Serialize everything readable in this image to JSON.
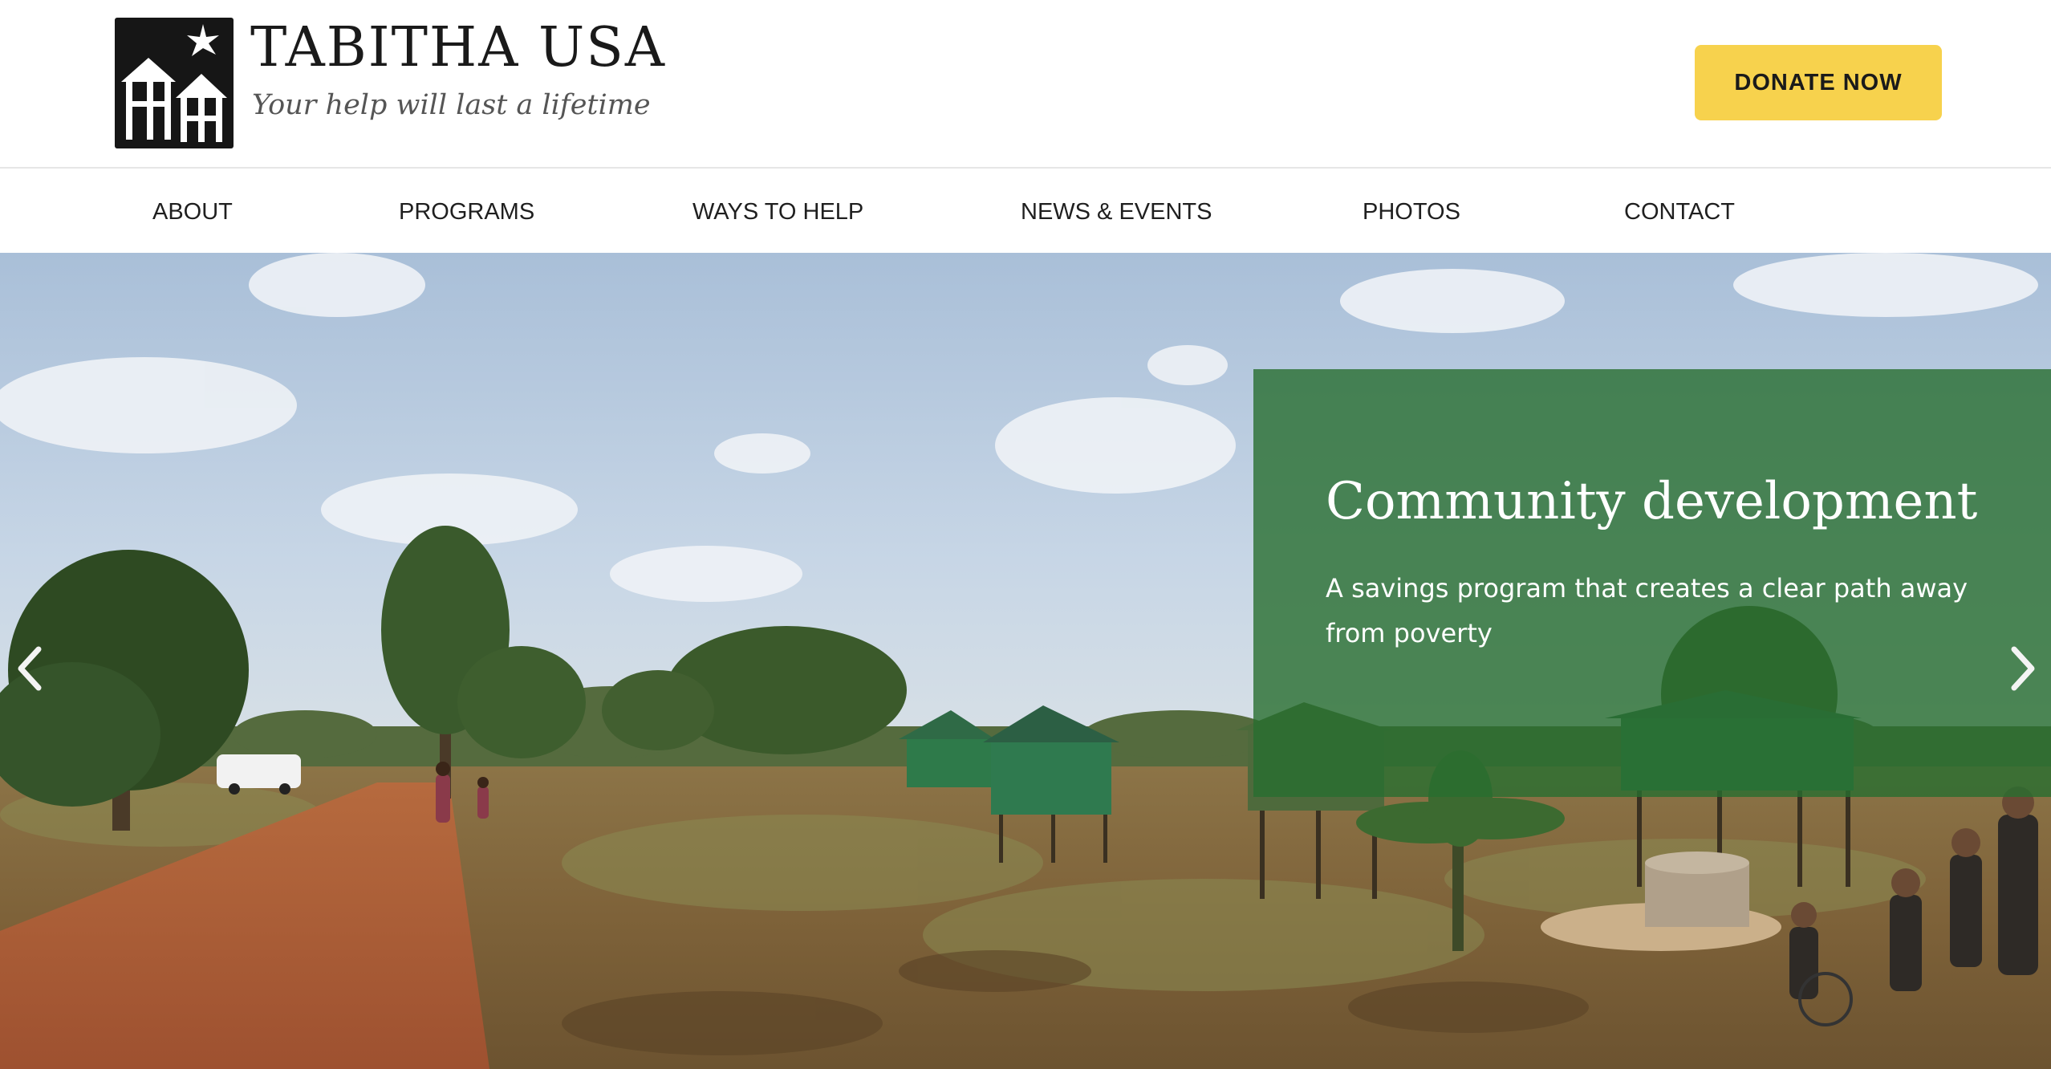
{
  "header": {
    "brand_name": "TABITHA USA",
    "tagline": "Your help will last a lifetime",
    "logo_icon": "houses-star-icon",
    "donate_label": "DONATE NOW",
    "donate_color": "#f7d24d"
  },
  "nav": {
    "items": [
      {
        "label": "ABOUT"
      },
      {
        "label": "PROGRAMS"
      },
      {
        "label": "WAYS TO HELP"
      },
      {
        "label": "NEWS & EVENTS"
      },
      {
        "label": "PHOTOS"
      },
      {
        "label": "CONTACT"
      }
    ]
  },
  "hero": {
    "slide_title": "Community development",
    "slide_text": "A savings program that creates a clear path away from poverty",
    "panel_color": "#286e30",
    "prev_icon": "chevron-left-icon",
    "next_icon": "chevron-right-icon"
  }
}
